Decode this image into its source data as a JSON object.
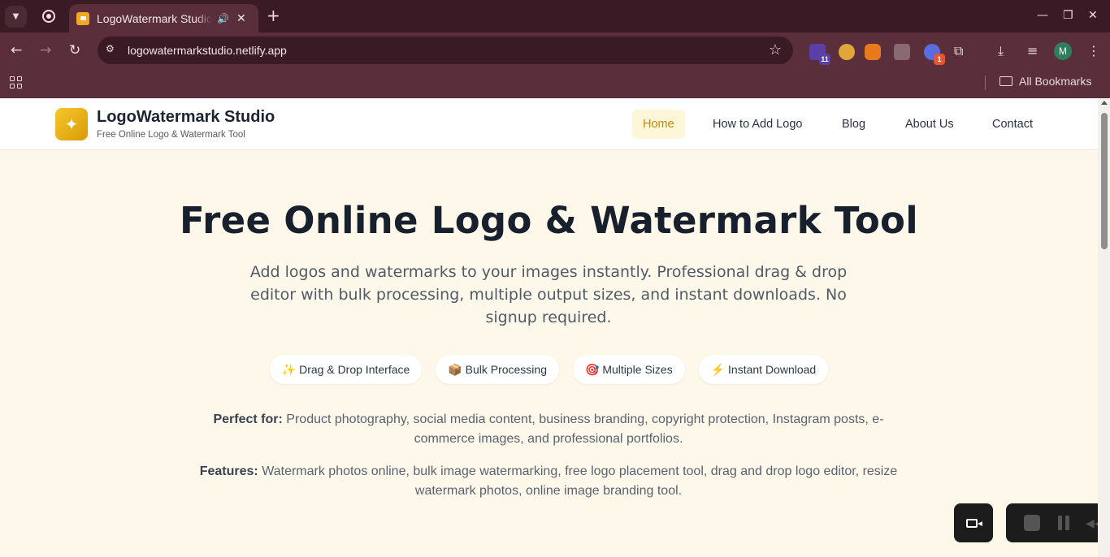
{
  "browser": {
    "tab": {
      "title": "LogoWatermark Studio"
    },
    "url": "logowatermarkstudio.netlify.app",
    "extensions": [
      {
        "name": "extension-1",
        "badge": "11",
        "color": "#5b3fa8"
      },
      {
        "name": "extension-2",
        "badge": "",
        "color": "#e0a63a"
      },
      {
        "name": "metamask-extension",
        "badge": "",
        "color": "#e8791c"
      },
      {
        "name": "screenshot-extension",
        "badge": "",
        "color": "#6a4a52"
      },
      {
        "name": "extension-5",
        "badge": "1",
        "color": "#5b6be0"
      }
    ],
    "profile_initial": "M",
    "bookmarks_label": "All Bookmarks"
  },
  "site": {
    "brand": {
      "name": "LogoWatermark Studio",
      "tagline": "Free Online Logo & Watermark Tool"
    },
    "nav": [
      {
        "label": "Home",
        "active": true
      },
      {
        "label": "How to Add Logo",
        "active": false
      },
      {
        "label": "Blog",
        "active": false
      },
      {
        "label": "About Us",
        "active": false
      },
      {
        "label": "Contact",
        "active": false
      }
    ],
    "hero": {
      "title": "Free Online Logo & Watermark Tool",
      "subtitle": "Add logos and watermarks to your images instantly. Professional drag & drop editor with bulk processing, multiple output sizes, and instant downloads. No signup required."
    },
    "features": [
      {
        "icon": "✨",
        "label": "Drag & Drop Interface"
      },
      {
        "icon": "📦",
        "label": "Bulk Processing"
      },
      {
        "icon": "🎯",
        "label": "Multiple Sizes"
      },
      {
        "icon": "⚡",
        "label": "Instant Download"
      }
    ],
    "perfect_for": {
      "label": "Perfect for:",
      "text": " Product photography, social media content, business branding, copyright protection, Instagram posts, e-commerce images, and professional portfolios."
    },
    "features_text": {
      "label": "Features:",
      "text": " Watermark photos online, bulk image watermarking, free logo placement tool, drag and drop logo editor, resize watermark photos, online image branding tool."
    }
  },
  "colors": {
    "accent": "#c68a00",
    "page_bg": "#fdf8ea",
    "chrome": "#5a2f3b"
  }
}
